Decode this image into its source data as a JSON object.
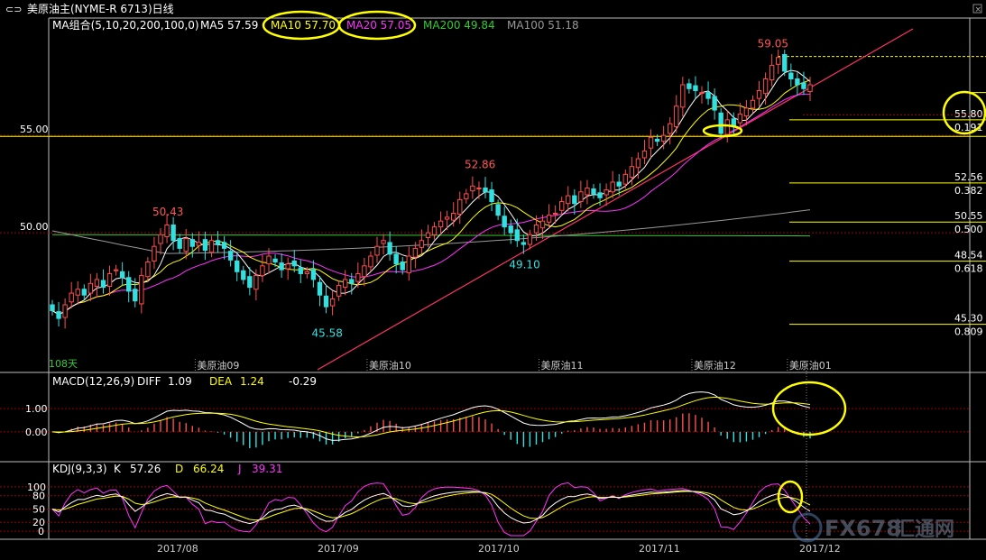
{
  "window": {
    "title": "美原油主(NYME-R 6713)日线"
  },
  "indicators": {
    "ma_label": "MA组合(5,10,20,200,100,0)",
    "ma5": "MA5 57.59",
    "ma10": "MA10 57.70",
    "ma20": "MA20 57.05",
    "ma200": "MA200 49.84",
    "ma100": "MA100 51.18",
    "macd_label": "MACD(12,26,9)",
    "macd_diff_label": "DIFF",
    "macd_diff_value": "1.09",
    "macd_dea_label": "DEA",
    "macd_dea_value": "1.24",
    "macd_macd_value": "-0.29",
    "kdj_label": "KDJ(9,3,3)",
    "kdj_k_label": "K",
    "kdj_k_value": "57.26",
    "kdj_d_label": "D",
    "kdj_d_value": "66.24",
    "kdj_j_label": "J",
    "kdj_j_value": "39.31"
  },
  "colors": {
    "background": "#000000",
    "up": "#ff4d4d",
    "down": "#33e0e0",
    "ma5": "#ffffff",
    "ma10": "#ffff00",
    "ma20": "#ff33ff",
    "ma200": "#33cc33",
    "ma100": "#999999",
    "grid": "#990000",
    "trendline": "#ff3366",
    "fib": "#ffff00",
    "highlight": "#ffff00"
  },
  "watermark": {
    "latin": "FX678",
    "cjk": "汇通网"
  },
  "bottom_left_label": "108天",
  "chart_data": [
    {
      "type": "candlestick",
      "panel": "price",
      "yaxis_ticks": [
        "55.00",
        "50.00"
      ],
      "ylim": [
        43.8,
        60.1
      ],
      "month_labels": [
        "美原油09",
        "美原油10",
        "美原油11",
        "美原油12",
        "美原油01"
      ],
      "date_labels": [
        "2017/08",
        "2017/09",
        "2017/10",
        "2017/11",
        "2017/12"
      ],
      "annotations": [
        {
          "text": "50.43",
          "value": 50.43,
          "index": 18
        },
        {
          "text": "45.58",
          "value": 45.58,
          "index": 43
        },
        {
          "text": "52.86",
          "value": 52.86,
          "index": 67
        },
        {
          "text": "49.10",
          "value": 49.1,
          "index": 74
        },
        {
          "text": "59.05",
          "value": 59.05,
          "index": 113
        }
      ],
      "fibonacci": [
        {
          "price": "55.80",
          "ratio": "0.191",
          "value": 55.8
        },
        {
          "price": "52.56",
          "ratio": "0.382",
          "value": 52.56
        },
        {
          "price": "50.55",
          "ratio": "0.500",
          "value": 50.55
        },
        {
          "price": "48.54",
          "ratio": "0.618",
          "value": 48.54
        },
        {
          "price": "45.30",
          "ratio": "0.809",
          "value": 45.3
        }
      ],
      "closes": [
        46.0,
        45.6,
        46.3,
        46.9,
        47.1,
        46.8,
        47.4,
        47.6,
        47.2,
        47.9,
        48.1,
        47.7,
        47.0,
        46.5,
        47.8,
        48.5,
        49.3,
        49.9,
        50.4,
        49.6,
        49.2,
        49.7,
        49.3,
        49.5,
        49.1,
        49.6,
        49.4,
        49.2,
        48.6,
        48.0,
        47.6,
        47.2,
        47.8,
        48.3,
        48.8,
        48.5,
        48.1,
        48.4,
        48.3,
        47.9,
        48.0,
        47.6,
        46.8,
        46.2,
        46.6,
        47.3,
        47.6,
        47.4,
        47.9,
        48.3,
        48.8,
        49.3,
        49.6,
        48.9,
        48.4,
        48.1,
        48.8,
        49.2,
        49.6,
        50.0,
        50.3,
        50.6,
        50.8,
        51.0,
        51.7,
        52.0,
        52.4,
        52.3,
        52.1,
        51.6,
        50.9,
        50.3,
        50.0,
        49.6,
        49.4,
        49.9,
        50.4,
        50.6,
        50.9,
        51.0,
        51.6,
        51.9,
        51.5,
        52.1,
        52.3,
        52.0,
        51.8,
        52.2,
        52.6,
        52.4,
        53.0,
        53.4,
        53.8,
        54.2,
        54.9,
        54.7,
        55.0,
        55.6,
        56.5,
        57.6,
        57.4,
        57.3,
        57.2,
        56.9,
        56.3,
        55.1,
        55.8,
        55.5,
        56.1,
        56.4,
        56.8,
        57.3,
        57.9,
        58.6,
        59.0,
        58.3,
        57.9,
        57.6,
        57.4,
        57.6
      ],
      "ma200_values": [
        49.9,
        49.84
      ],
      "ma100_values": [
        48.9,
        51.18
      ]
    },
    {
      "type": "macd",
      "panel": "macd",
      "yaxis_ticks": [
        "1.00",
        "0.00"
      ],
      "ylim": [
        -0.9,
        1.9
      ],
      "diff": 1.09,
      "dea": 1.24,
      "macd": -0.29
    },
    {
      "type": "kdj",
      "panel": "kdj",
      "yaxis_ticks": [
        "100",
        "80",
        "50",
        "20",
        "0"
      ],
      "ylim": [
        -12,
        120
      ],
      "k": 57.26,
      "d": 66.24,
      "j": 39.31
    }
  ]
}
